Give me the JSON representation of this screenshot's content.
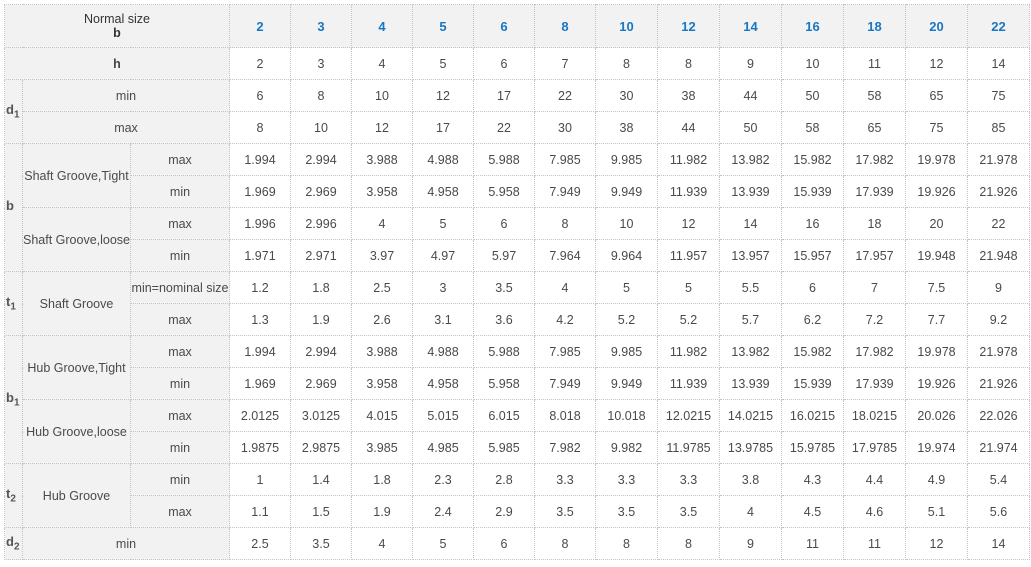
{
  "header": {
    "nominal_label": "Normal size",
    "nominal_sub": "b",
    "sizes": [
      "2",
      "3",
      "4",
      "5",
      "6",
      "8",
      "10",
      "12",
      "14",
      "16",
      "18",
      "20",
      "22"
    ]
  },
  "symbols": {
    "d1": {
      "base": "d",
      "sub": "1"
    },
    "b": {
      "base": "b",
      "sub": ""
    },
    "t1": {
      "base": "t",
      "sub": "1"
    },
    "b1": {
      "base": "b",
      "sub": "1"
    },
    "t2": {
      "base": "t",
      "sub": "2"
    },
    "d2": {
      "base": "d",
      "sub": "2"
    }
  },
  "rows": {
    "h": {
      "label": "h",
      "values": [
        "2",
        "3",
        "4",
        "5",
        "6",
        "7",
        "8",
        "8",
        "9",
        "10",
        "11",
        "12",
        "14"
      ]
    },
    "d1_min": {
      "label": "min",
      "values": [
        "6",
        "8",
        "10",
        "12",
        "17",
        "22",
        "30",
        "38",
        "44",
        "50",
        "58",
        "65",
        "75"
      ]
    },
    "d1_max": {
      "label": "max",
      "values": [
        "8",
        "10",
        "12",
        "17",
        "22",
        "30",
        "38",
        "44",
        "50",
        "58",
        "65",
        "75",
        "85"
      ]
    },
    "b_tight_label": "Shaft Groove,Tight",
    "b_tight_max": {
      "label": "max",
      "values": [
        "1.994",
        "2.994",
        "3.988",
        "4.988",
        "5.988",
        "7.985",
        "9.985",
        "11.982",
        "13.982",
        "15.982",
        "17.982",
        "19.978",
        "21.978"
      ]
    },
    "b_tight_min": {
      "label": "min",
      "values": [
        "1.969",
        "2.969",
        "3.958",
        "4.958",
        "5.958",
        "7.949",
        "9.949",
        "11.939",
        "13.939",
        "15.939",
        "17.939",
        "19.926",
        "21.926"
      ]
    },
    "b_loose_label": "Shaft Groove,loose",
    "b_loose_max": {
      "label": "max",
      "values": [
        "1.996",
        "2.996",
        "4",
        "5",
        "6",
        "8",
        "10",
        "12",
        "14",
        "16",
        "18",
        "20",
        "22"
      ]
    },
    "b_loose_min": {
      "label": "min",
      "values": [
        "1.971",
        "2.971",
        "3.97",
        "4.97",
        "5.97",
        "7.964",
        "9.964",
        "11.957",
        "13.957",
        "15.957",
        "17.957",
        "19.948",
        "21.948"
      ]
    },
    "t1_label": "Shaft Groove",
    "t1_min": {
      "label": "min=nominal size",
      "values": [
        "1.2",
        "1.8",
        "2.5",
        "3",
        "3.5",
        "4",
        "5",
        "5",
        "5.5",
        "6",
        "7",
        "7.5",
        "9"
      ]
    },
    "t1_max": {
      "label": "max",
      "values": [
        "1.3",
        "1.9",
        "2.6",
        "3.1",
        "3.6",
        "4.2",
        "5.2",
        "5.2",
        "5.7",
        "6.2",
        "7.2",
        "7.7",
        "9.2"
      ]
    },
    "b1_tight_label": "Hub Groove,Tight",
    "b1_tight_max": {
      "label": "max",
      "values": [
        "1.994",
        "2.994",
        "3.988",
        "4.988",
        "5.988",
        "7.985",
        "9.985",
        "11.982",
        "13.982",
        "15.982",
        "17.982",
        "19.978",
        "21.978"
      ]
    },
    "b1_tight_min": {
      "label": "min",
      "values": [
        "1.969",
        "2.969",
        "3.958",
        "4.958",
        "5.958",
        "7.949",
        "9.949",
        "11.939",
        "13.939",
        "15.939",
        "17.939",
        "19.926",
        "21.926"
      ]
    },
    "b1_loose_label": "Hub Groove,loose",
    "b1_loose_max": {
      "label": "max",
      "values": [
        "2.0125",
        "3.0125",
        "4.015",
        "5.015",
        "6.015",
        "8.018",
        "10.018",
        "12.0215",
        "14.0215",
        "16.0215",
        "18.0215",
        "20.026",
        "22.026"
      ]
    },
    "b1_loose_min": {
      "label": "min",
      "values": [
        "1.9875",
        "2.9875",
        "3.985",
        "4.985",
        "5.985",
        "7.982",
        "9.982",
        "11.9785",
        "13.9785",
        "15.9785",
        "17.9785",
        "19.974",
        "21.974"
      ]
    },
    "t2_label": "Hub Groove",
    "t2_min": {
      "label": "min",
      "values": [
        "1",
        "1.4",
        "1.8",
        "2.3",
        "2.8",
        "3.3",
        "3.3",
        "3.3",
        "3.8",
        "4.3",
        "4.4",
        "4.9",
        "5.4"
      ]
    },
    "t2_max": {
      "label": "max",
      "values": [
        "1.1",
        "1.5",
        "1.9",
        "2.4",
        "2.9",
        "3.5",
        "3.5",
        "3.5",
        "4",
        "4.5",
        "4.6",
        "5.1",
        "5.6"
      ]
    },
    "d2_min": {
      "label": "min",
      "values": [
        "2.5",
        "3.5",
        "4",
        "5",
        "6",
        "8",
        "8",
        "8",
        "9",
        "11",
        "11",
        "12",
        "14"
      ]
    }
  }
}
